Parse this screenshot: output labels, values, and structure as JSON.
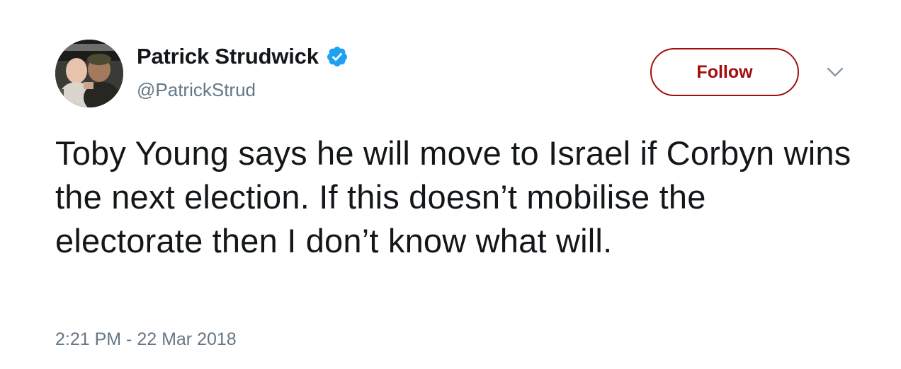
{
  "tweet": {
    "author": {
      "display_name": "Patrick Strudwick",
      "handle": "@PatrickStrud",
      "verified": true,
      "avatar_icon": "profile-photo"
    },
    "follow_label": "Follow",
    "menu_icon": "chevron-down-icon",
    "text": "Toby Young says he will move to Israel if Corbyn wins the next election. If this doesn’t mobilise the electorate then I don’t know what will.",
    "timestamp": "2:21 PM - 22 Mar 2018"
  },
  "colors": {
    "follow_accent": "#a30d0d",
    "verified_blue": "#1da1f2",
    "text_primary": "#14171a",
    "text_secondary": "#657786"
  }
}
